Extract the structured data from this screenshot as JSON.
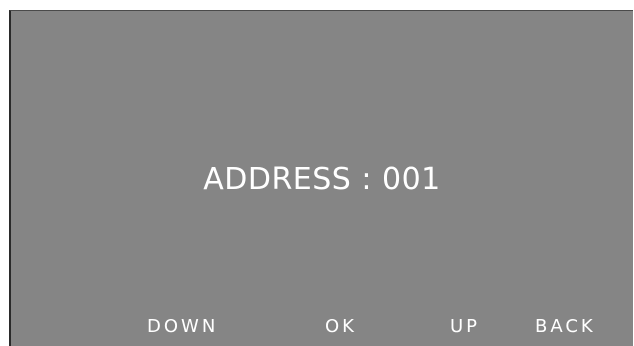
{
  "display": {
    "address_label": "ADDRESS : 001"
  },
  "softkeys": {
    "down": "DOWN",
    "ok": "OK",
    "up": "UP",
    "back": "BACK"
  },
  "colors": {
    "screen_background": "#858585",
    "text": "#ffffff"
  }
}
